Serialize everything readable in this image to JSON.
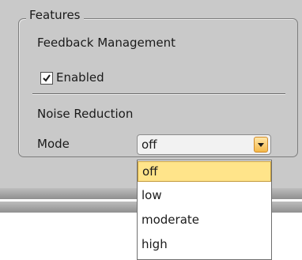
{
  "group": {
    "legend": "Features",
    "feedback_label": "Feedback Management",
    "enabled_label": "Enabled",
    "enabled_checked": true,
    "noise_label": "Noise Reduction",
    "mode_label": "Mode"
  },
  "mode_select": {
    "value": "off",
    "options": [
      "off",
      "low",
      "moderate",
      "high"
    ],
    "highlighted": "off"
  }
}
